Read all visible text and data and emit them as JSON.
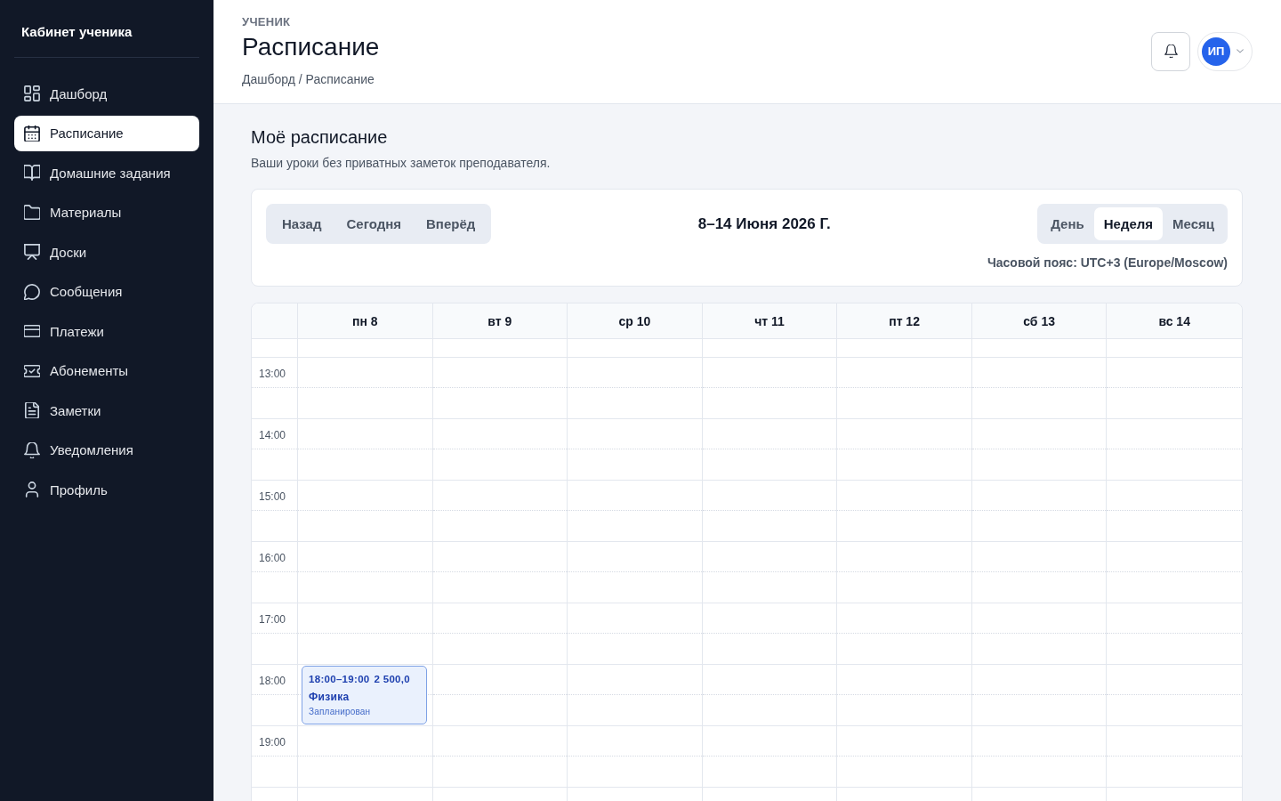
{
  "sidebar": {
    "title": "Кабинет ученика",
    "items": [
      {
        "label": "Дашборд",
        "selected": false
      },
      {
        "label": "Расписание",
        "selected": true
      },
      {
        "label": "Домашние задания",
        "selected": false
      },
      {
        "label": "Материалы",
        "selected": false
      },
      {
        "label": "Доски",
        "selected": false
      },
      {
        "label": "Сообщения",
        "selected": false
      },
      {
        "label": "Платежи",
        "selected": false
      },
      {
        "label": "Абонементы",
        "selected": false
      },
      {
        "label": "Заметки",
        "selected": false
      },
      {
        "label": "Уведомления",
        "selected": false
      },
      {
        "label": "Профиль",
        "selected": false
      }
    ]
  },
  "header": {
    "eyebrow": "УЧЕНИК",
    "title": "Расписание",
    "breadcrumb": "Дашборд / Расписание",
    "avatar": "ИП"
  },
  "page": {
    "title": "Моё расписание",
    "subtitle": "Ваши уроки без приватных заметок преподавателя."
  },
  "toolbar": {
    "nav_buttons": [
      "Назад",
      "Сегодня",
      "Вперёд"
    ],
    "range": "8–14 Июня 2026 Г.",
    "views": [
      {
        "label": "День",
        "selected": false
      },
      {
        "label": "Неделя",
        "selected": true
      },
      {
        "label": "Месяц",
        "selected": false
      }
    ],
    "timezone": "Часовой пояс: UTC+3 (Europe/Moscow)"
  },
  "calendar": {
    "days": [
      "пн 8",
      "вт 9",
      "ср 10",
      "чт 11",
      "пт 12",
      "сб 13",
      "вс 14"
    ],
    "hours": [
      {
        "label": "13:00"
      },
      {
        "label": "14:00"
      },
      {
        "label": "15:00"
      },
      {
        "label": "16:00"
      },
      {
        "label": "17:00"
      },
      {
        "label": "18:00",
        "cells": [
          {
            "events": [
              {
                "time": "18:00–19:00",
                "price": "2 500,0",
                "title": "Физика",
                "status": "Запланирован"
              }
            ]
          }
        ]
      },
      {
        "label": "19:00"
      }
    ]
  }
}
